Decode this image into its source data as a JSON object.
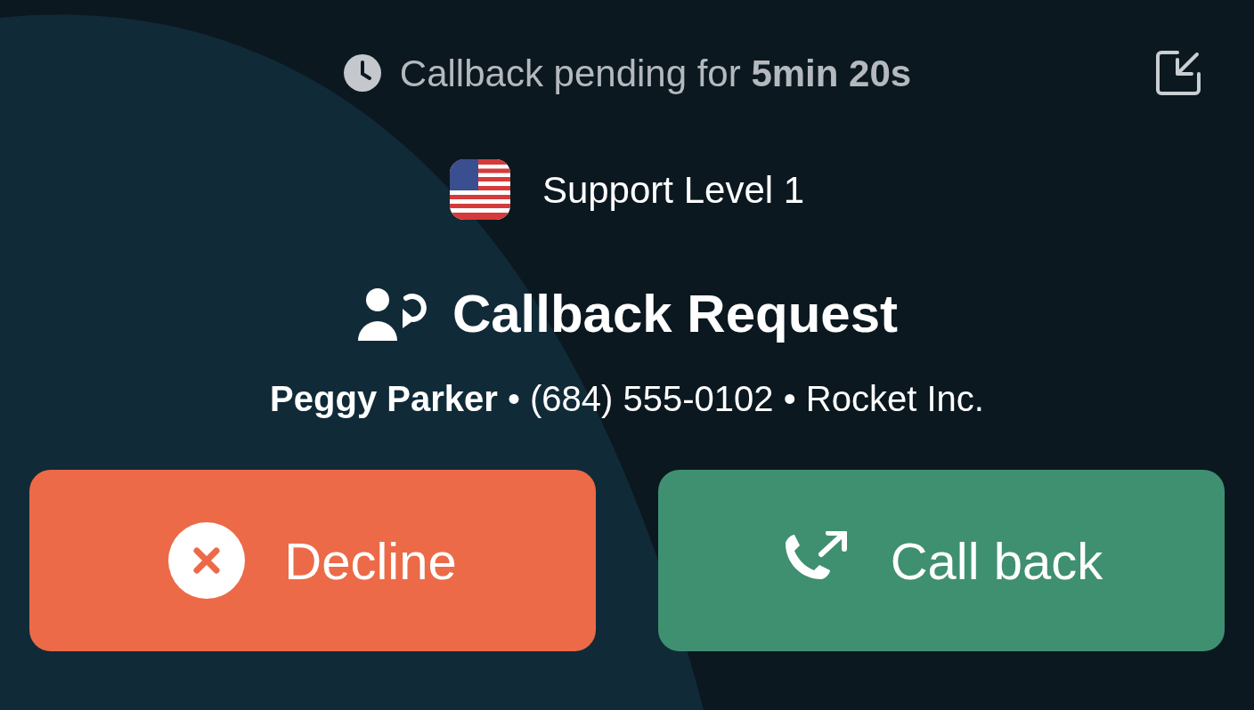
{
  "pending": {
    "text": "Callback pending for **5min 20s**"
  },
  "queue": {
    "label": "Support Level 1"
  },
  "title": "Callback Request",
  "caller": "**Peggy Parker** • (684) 555-0102 • Rocket Inc.",
  "buttons": [
    {
      "kind": "decline",
      "label": "Decline"
    },
    {
      "kind": "callback",
      "label": "Call back"
    }
  ]
}
